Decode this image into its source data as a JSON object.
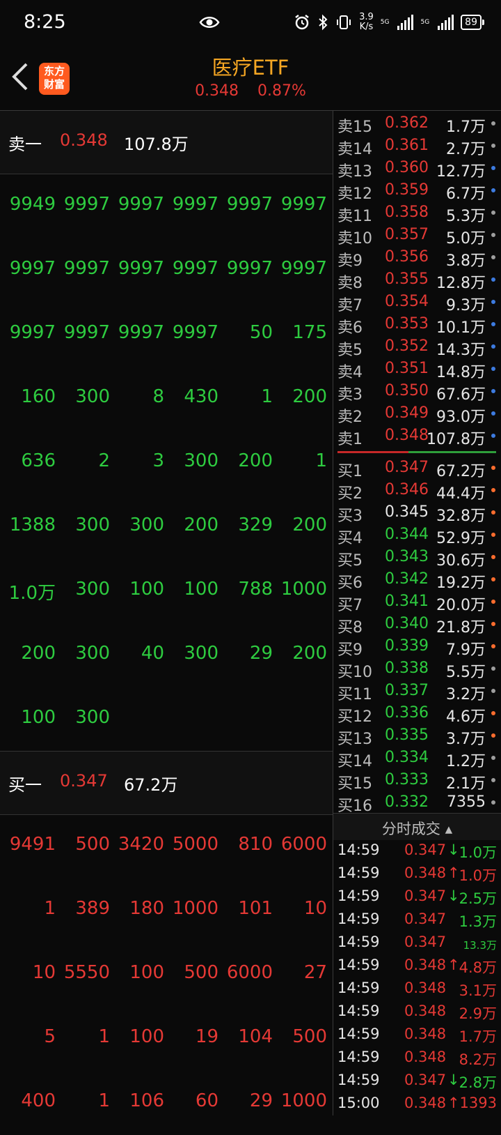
{
  "status": {
    "time": "8:25",
    "speed_value": "3.9",
    "speed_unit": "K/s",
    "net1": "5G",
    "net2": "5G",
    "battery": "89"
  },
  "header": {
    "title": "医疗ETF",
    "price": "0.348",
    "change": "0.87%",
    "logo_line1": "东方",
    "logo_line2": "财富"
  },
  "sell_summary": {
    "label": "卖一",
    "price": "0.348",
    "volume": "107.8万"
  },
  "sell_queue": [
    [
      "9949",
      "9997",
      "9997",
      "9997",
      "9997",
      "9997"
    ],
    [
      "9997",
      "9997",
      "9997",
      "9997",
      "9997",
      "9997"
    ],
    [
      "9997",
      "9997",
      "9997",
      "9997",
      "50",
      "175"
    ],
    [
      "160",
      "300",
      "8",
      "430",
      "1",
      "200"
    ],
    [
      "636",
      "2",
      "3",
      "300",
      "200",
      "1"
    ],
    [
      "1388",
      "300",
      "300",
      "200",
      "329",
      "200"
    ],
    [
      "1.0万",
      "300",
      "100",
      "100",
      "788",
      "1000"
    ],
    [
      "200",
      "300",
      "40",
      "300",
      "29",
      "200"
    ],
    [
      "100",
      "300",
      "",
      "",
      "",
      ""
    ]
  ],
  "buy_summary": {
    "label": "买一",
    "price": "0.347",
    "volume": "67.2万"
  },
  "buy_queue": [
    [
      "9491",
      "500",
      "3420",
      "5000",
      "810",
      "6000"
    ],
    [
      "1",
      "389",
      "180",
      "1000",
      "101",
      "10"
    ],
    [
      "10",
      "5550",
      "100",
      "500",
      "6000",
      "27"
    ],
    [
      "5",
      "1",
      "100",
      "19",
      "104",
      "500"
    ],
    [
      "400",
      "1",
      "106",
      "60",
      "29",
      "1000"
    ]
  ],
  "asks": [
    {
      "label": "卖15",
      "price": "0.362",
      "volume": "1.7万",
      "dot": "grey"
    },
    {
      "label": "卖14",
      "price": "0.361",
      "volume": "2.7万",
      "dot": "grey"
    },
    {
      "label": "卖13",
      "price": "0.360",
      "volume": "12.7万",
      "dot": "blue"
    },
    {
      "label": "卖12",
      "price": "0.359",
      "volume": "6.7万",
      "dot": "blue"
    },
    {
      "label": "卖11",
      "price": "0.358",
      "volume": "5.3万",
      "dot": "grey"
    },
    {
      "label": "卖10",
      "price": "0.357",
      "volume": "5.0万",
      "dot": "grey"
    },
    {
      "label": "卖9",
      "price": "0.356",
      "volume": "3.8万",
      "dot": "grey"
    },
    {
      "label": "卖8",
      "price": "0.355",
      "volume": "12.8万",
      "dot": "blue"
    },
    {
      "label": "卖7",
      "price": "0.354",
      "volume": "9.3万",
      "dot": "blue"
    },
    {
      "label": "卖6",
      "price": "0.353",
      "volume": "10.1万",
      "dot": "blue"
    },
    {
      "label": "卖5",
      "price": "0.352",
      "volume": "14.3万",
      "dot": "blue"
    },
    {
      "label": "卖4",
      "price": "0.351",
      "volume": "14.8万",
      "dot": "blue"
    },
    {
      "label": "卖3",
      "price": "0.350",
      "volume": "67.6万",
      "dot": "blue"
    },
    {
      "label": "卖2",
      "price": "0.349",
      "volume": "93.0万",
      "dot": "blue"
    },
    {
      "label": "卖1",
      "price": "0.348",
      "volume": "107.8万",
      "dot": "blue"
    }
  ],
  "bids": [
    {
      "label": "买1",
      "price": "0.347",
      "volume": "67.2万",
      "dot": "orange",
      "color": "red"
    },
    {
      "label": "买2",
      "price": "0.346",
      "volume": "44.4万",
      "dot": "orange",
      "color": "red"
    },
    {
      "label": "买3",
      "price": "0.345",
      "volume": "32.8万",
      "dot": "orange",
      "color": "white"
    },
    {
      "label": "买4",
      "price": "0.344",
      "volume": "52.9万",
      "dot": "orange",
      "color": "green"
    },
    {
      "label": "买5",
      "price": "0.343",
      "volume": "30.6万",
      "dot": "orange",
      "color": "green"
    },
    {
      "label": "买6",
      "price": "0.342",
      "volume": "19.2万",
      "dot": "orange",
      "color": "green"
    },
    {
      "label": "买7",
      "price": "0.341",
      "volume": "20.0万",
      "dot": "orange",
      "color": "green"
    },
    {
      "label": "买8",
      "price": "0.340",
      "volume": "21.8万",
      "dot": "orange",
      "color": "green"
    },
    {
      "label": "买9",
      "price": "0.339",
      "volume": "7.9万",
      "dot": "orange",
      "color": "green"
    },
    {
      "label": "买10",
      "price": "0.338",
      "volume": "5.5万",
      "dot": "grey",
      "color": "green"
    },
    {
      "label": "买11",
      "price": "0.337",
      "volume": "3.2万",
      "dot": "grey",
      "color": "green"
    },
    {
      "label": "买12",
      "price": "0.336",
      "volume": "4.6万",
      "dot": "orange",
      "color": "green"
    },
    {
      "label": "买13",
      "price": "0.335",
      "volume": "3.7万",
      "dot": "orange",
      "color": "green"
    },
    {
      "label": "买14",
      "price": "0.334",
      "volume": "1.2万",
      "dot": "grey",
      "color": "green"
    },
    {
      "label": "买15",
      "price": "0.333",
      "volume": "2.1万",
      "dot": "grey",
      "color": "green"
    },
    {
      "label": "买16",
      "price": "0.332",
      "volume": "7355",
      "dot": "grey",
      "color": "green"
    }
  ],
  "trades_title": "分时成交",
  "trades": [
    {
      "time": "14:59",
      "price": "0.347",
      "arrow": "↓",
      "volume": "1.0万",
      "color": "green"
    },
    {
      "time": "14:59",
      "price": "0.348",
      "arrow": "↑",
      "volume": "1.0万",
      "color": "red"
    },
    {
      "time": "14:59",
      "price": "0.347",
      "arrow": "↓",
      "volume": "2.5万",
      "color": "green"
    },
    {
      "time": "14:59",
      "price": "0.347",
      "arrow": "",
      "volume": "1.3万",
      "color": "green"
    },
    {
      "time": "14:59",
      "price": "0.347",
      "arrow": "",
      "volume": "13.3万",
      "color": "green",
      "small": true
    },
    {
      "time": "14:59",
      "price": "0.348",
      "arrow": "↑",
      "volume": "4.8万",
      "color": "red"
    },
    {
      "time": "14:59",
      "price": "0.348",
      "arrow": "",
      "volume": "3.1万",
      "color": "red"
    },
    {
      "time": "14:59",
      "price": "0.348",
      "arrow": "",
      "volume": "2.9万",
      "color": "red"
    },
    {
      "time": "14:59",
      "price": "0.348",
      "arrow": "",
      "volume": "1.7万",
      "color": "red"
    },
    {
      "time": "14:59",
      "price": "0.348",
      "arrow": "",
      "volume": "8.2万",
      "color": "red"
    },
    {
      "time": "14:59",
      "price": "0.347",
      "arrow": "↓",
      "volume": "2.8万",
      "color": "green"
    },
    {
      "time": "15:00",
      "price": "0.348",
      "arrow": "↑",
      "volume": "1393",
      "color": "red"
    }
  ]
}
